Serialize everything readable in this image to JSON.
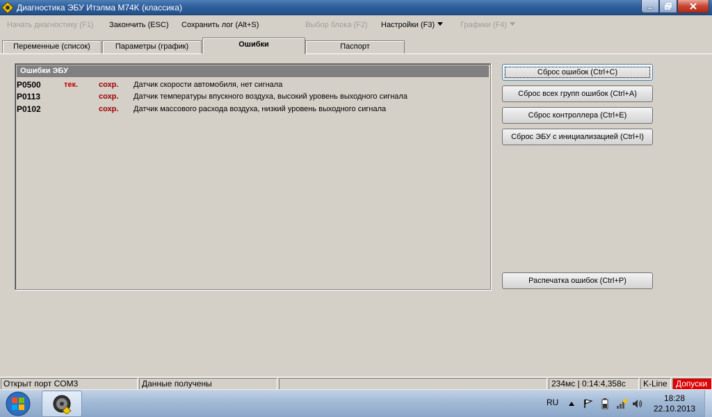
{
  "window": {
    "title": "Диагностика ЭБУ Итэлма M74K (классика)"
  },
  "menu": {
    "items": [
      {
        "label": "Начать диагностику (F1)",
        "enabled": false
      },
      {
        "label": "Закончить (ESC)",
        "enabled": true
      },
      {
        "label": "Сохранить лог (Alt+S)",
        "enabled": true
      },
      {
        "label": "Выбор блока (F2)",
        "enabled": false
      },
      {
        "label": "Настройки (F3)",
        "enabled": true,
        "dropdown": true
      },
      {
        "label": "Графики (F4)",
        "enabled": false,
        "dropdown": true
      }
    ]
  },
  "tabs": [
    {
      "label": "Переменные (список)",
      "active": false
    },
    {
      "label": "Параметры (график)",
      "active": false
    },
    {
      "label": "Ошибки",
      "active": true
    },
    {
      "label": "Паспорт",
      "active": false
    }
  ],
  "errors_panel": {
    "title": "Ошибки ЭБУ",
    "rows": [
      {
        "code": "P0500",
        "current": "тек.",
        "saved": "сохр.",
        "description": "Датчик скорости автомобиля, нет сигнала"
      },
      {
        "code": "P0113",
        "current": "",
        "saved": "сохр.",
        "description": "Датчик температуры впускного воздуха, высокий уровень выходного сигнала"
      },
      {
        "code": "P0102",
        "current": "",
        "saved": "сохр.",
        "description": "Датчик массового расхода воздуха, низкий уровень выходного сигнала"
      }
    ]
  },
  "buttons": {
    "reset_errors": "Сброс ошибок (Ctrl+C)",
    "reset_all_groups": "Сброс всех групп ошибок (Ctrl+A)",
    "reset_controller": "Сброс контроллера (Ctrl+E)",
    "reset_ecu_init": "Сброс ЭБУ с инициализацией (Ctrl+I)",
    "print_errors": "Распечатка ошибок (Ctrl+P)"
  },
  "statusbar": {
    "port": "Открыт порт COM3",
    "data": "Данные получены",
    "timing": "234мс | 0:14:4,358с",
    "protocol": "K-Line",
    "alert": "Допуски"
  },
  "taskbar": {
    "language": "RU",
    "time": "18:28",
    "date": "22.10.2013"
  },
  "colors": {
    "titlebar": "#2f5f9c",
    "window_bg": "#d4d0c8",
    "current_error": "#c00000",
    "saved_error": "#a00000",
    "alert_bg": "#e00000"
  }
}
